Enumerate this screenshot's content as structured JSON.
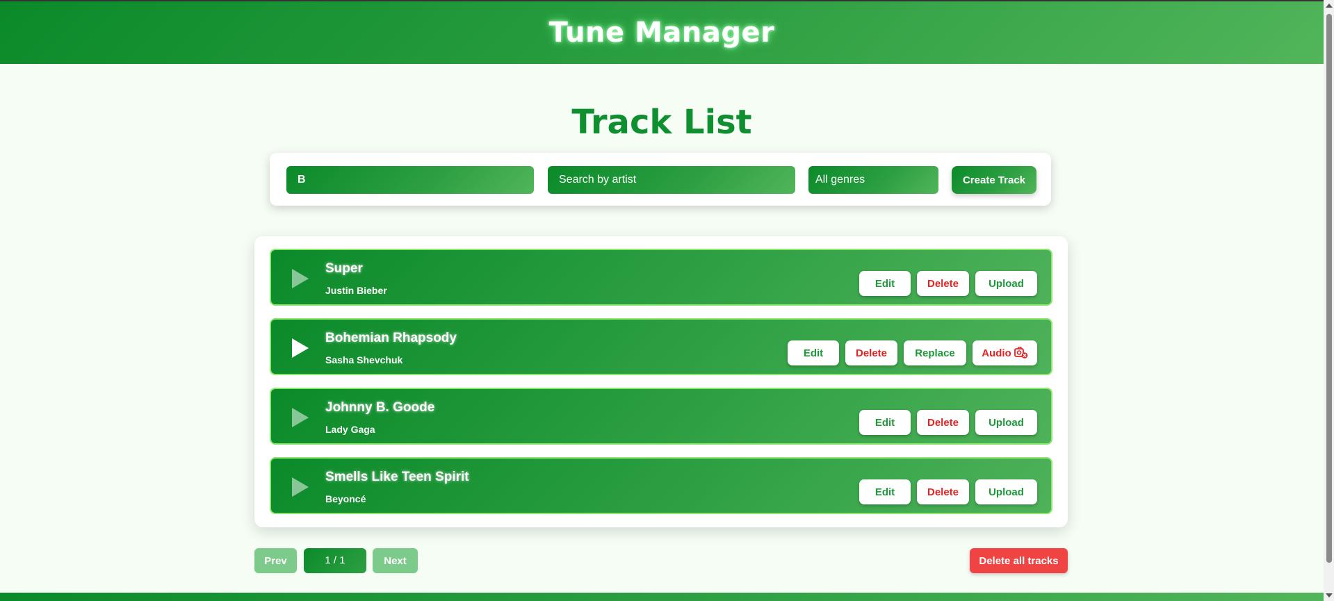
{
  "app": {
    "title": "Tune Manager"
  },
  "main": {
    "heading": "Track List"
  },
  "filters": {
    "title_value": "B",
    "artist_placeholder": "Search by artist",
    "genre_selected": "All genres",
    "create_label": "Create Track"
  },
  "tracks": [
    {
      "title": "Super",
      "artist": "Justin Bieber",
      "playing": false,
      "actions": [
        "Edit",
        "Delete",
        "Upload"
      ]
    },
    {
      "title": "Bohemian Rhapsody",
      "artist": "Sasha Shevchuk",
      "playing": true,
      "actions": [
        "Edit",
        "Delete",
        "Replace",
        "Audio"
      ]
    },
    {
      "title": "Johnny B. Goode",
      "artist": "Lady Gaga",
      "playing": false,
      "actions": [
        "Edit",
        "Delete",
        "Upload"
      ]
    },
    {
      "title": "Smells Like Teen Spirit",
      "artist": "Beyoncé",
      "playing": false,
      "actions": [
        "Edit",
        "Delete",
        "Upload"
      ]
    }
  ],
  "pagination": {
    "prev_label": "Prev",
    "page_indicator": "1 / 1",
    "next_label": "Next"
  },
  "bulk": {
    "delete_all_label": "Delete all tracks"
  },
  "colors": {
    "brand_green": "#0b8a2a",
    "accent_green": "#2ea043",
    "danger_red": "#e52222",
    "background": "#f5fdf5"
  }
}
